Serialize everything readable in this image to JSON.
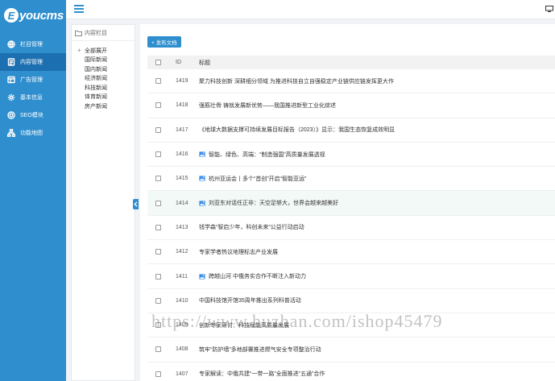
{
  "brand": {
    "logo_letter": "E",
    "logo_text": "youcms"
  },
  "colors": {
    "primary": "#2e8ece",
    "active_nav": "#1c6fb0",
    "image_icon": "#3a8ee6"
  },
  "sidebar": {
    "items": [
      {
        "label": "栏目管理",
        "icon": "globe-icon",
        "active": false
      },
      {
        "label": "内容管理",
        "icon": "document-icon",
        "active": true
      },
      {
        "label": "广告管理",
        "icon": "layout-icon",
        "active": false
      },
      {
        "label": "基本信息",
        "icon": "gear-icon",
        "active": false
      },
      {
        "label": "SEO模块",
        "icon": "target-icon",
        "active": false
      },
      {
        "label": "功能地图",
        "icon": "sitemap-icon",
        "active": false
      }
    ]
  },
  "tree": {
    "title": "内容栏目",
    "root": {
      "label": "全部展开"
    },
    "nodes": [
      {
        "label": "国际新闻"
      },
      {
        "label": "国内新闻"
      },
      {
        "label": "经济新闻"
      },
      {
        "label": "科技新闻"
      },
      {
        "label": "体育新闻"
      },
      {
        "label": "房产新闻"
      }
    ]
  },
  "main": {
    "publish_label": "+ 发布文档",
    "columns": {
      "id": "ID",
      "title": "标题"
    },
    "rows": [
      {
        "id": "1419",
        "title": "聚力科技创新 深耕细分领域 为推进科技自立自强稳定产业链供应链发挥更大作",
        "has_image": false
      },
      {
        "id": "1418",
        "title": "强筋壮骨 铸就发展新优势——我国推进新型工业化综述",
        "has_image": false
      },
      {
        "id": "1417",
        "title": "《地球大数据支撑可持续发展目标报告（2023）》显示：我国生态恢复成效明显",
        "has_image": false
      },
      {
        "id": "1416",
        "title": "智能、绿色、高端：“制造强国”高质量发展透视",
        "has_image": true
      },
      {
        "id": "1415",
        "title": "杭州亚运会丨多个“首创”开启“智能亚运”",
        "has_image": true
      },
      {
        "id": "1414",
        "title": "刘亚东对话任正非：天空足够大，世界会越来越美好",
        "has_image": true
      },
      {
        "id": "1413",
        "title": "钱学森“智启少年，科创未来”公益行动启动",
        "has_image": false
      },
      {
        "id": "1412",
        "title": "专家学者热议地理标志产业发展",
        "has_image": false
      },
      {
        "id": "1411",
        "title": "跨越山河 中俄务实合作不断注入新动力",
        "has_image": true
      },
      {
        "id": "1410",
        "title": "中国科技馆开馆35周年推出系列科普活动",
        "has_image": false
      },
      {
        "id": "1409",
        "title": "创新专家研讨：科技赋能高质量发展",
        "has_image": false
      },
      {
        "id": "1408",
        "title": "筑牢“防护墙”多地部署推进燃气安全专项整治行动",
        "has_image": false
      },
      {
        "id": "1407",
        "title": "专家解读：中俄共建“一带一路”全面推进“五通”合作",
        "has_image": false
      }
    ]
  },
  "watermark": "https://www.huzhan.com/ishop45479"
}
